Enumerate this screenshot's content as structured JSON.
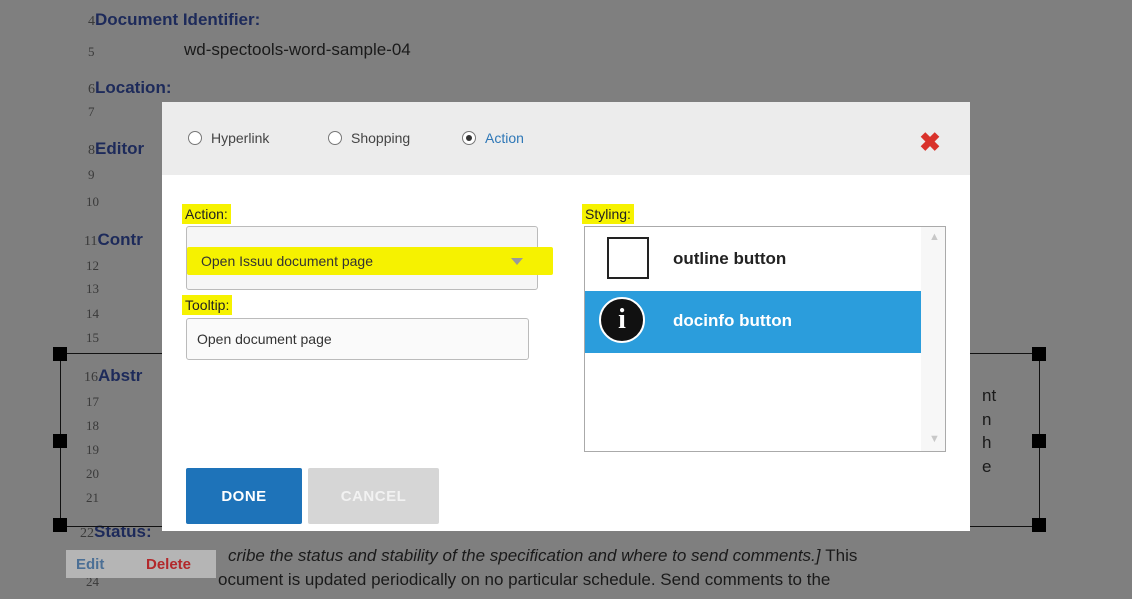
{
  "document": {
    "sections": [
      {
        "num": "4",
        "title": "Document Identifier:"
      },
      {
        "num": "6",
        "title": "Location:"
      },
      {
        "num": "8",
        "title": "Editor"
      },
      {
        "num": "11",
        "title": "Contr"
      },
      {
        "num": "16",
        "title": "Abstr"
      },
      {
        "num": "22",
        "title": "Status:"
      }
    ],
    "line_numbers": [
      "5",
      "7",
      "9",
      "10",
      "12",
      "13",
      "14",
      "15",
      "17",
      "18",
      "19",
      "20",
      "21",
      "24"
    ],
    "identifier_value": "wd-spectools-word-sample-04",
    "right_fragments": [
      "nt",
      "n",
      "h",
      "e"
    ],
    "status_line_1": "cribe the status and stability of the specification and where to send comments.]",
    "status_line_1b": "This",
    "status_line_2": "ocument is updated periodically on no particular schedule. Send comments to the"
  },
  "edit_bar": {
    "edit": "Edit",
    "delete": "Delete"
  },
  "dialog": {
    "link_types": [
      {
        "label": "Hyperlink",
        "selected": false
      },
      {
        "label": "Shopping",
        "selected": false
      },
      {
        "label": "Action",
        "selected": true
      }
    ],
    "close_icon": "close-x-icon",
    "action_label": "Action:",
    "action_value": "Open Issuu document page",
    "tooltip_label": "Tooltip:",
    "tooltip_value": "Open document page",
    "styling_label": "Styling:",
    "styles": [
      {
        "label": "outline button",
        "icon": "outline-square-icon",
        "selected": false
      },
      {
        "label": "docinfo button",
        "icon": "info-circle-icon",
        "selected": true
      }
    ],
    "done_label": "DONE",
    "cancel_label": "CANCEL",
    "colors": {
      "highlight": "#f6f200",
      "selected": "#2b9ddc",
      "primary": "#1e73b9",
      "close": "#d9322b"
    }
  }
}
